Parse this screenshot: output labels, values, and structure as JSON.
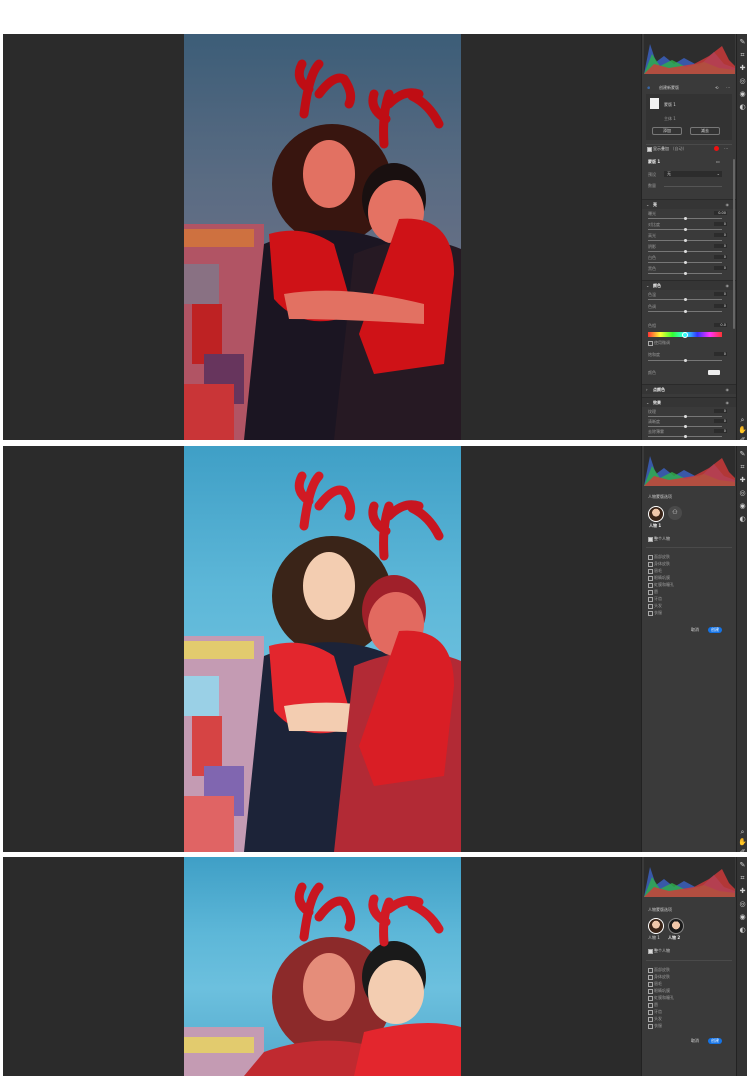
{
  "shot1": {
    "panel": {
      "mask_header": "创建新蒙版",
      "mask_name": "蒙版 1",
      "subject_label": "主体 1",
      "add_label": "添加",
      "subtract_label": "减去",
      "mask_overlay_label": "显示叠加",
      "overlay_mode": "(自动)",
      "mask_section": "蒙版 1",
      "preset_label": "预设",
      "preset_value": "无",
      "amount_label": "数量",
      "light_section": "亮",
      "sliders_light": [
        {
          "label": "曝光",
          "value": "0.00"
        },
        {
          "label": "对比度",
          "value": "0"
        },
        {
          "label": "高光",
          "value": "0"
        },
        {
          "label": "阴影",
          "value": "0"
        },
        {
          "label": "白色",
          "value": "0"
        },
        {
          "label": "黑色",
          "value": "0"
        }
      ],
      "color_section": "颜色",
      "sliders_color": [
        {
          "label": "色温",
          "value": "0"
        },
        {
          "label": "色调",
          "value": "0"
        }
      ],
      "hue_label": "色相",
      "hue_value": "0.0",
      "fine_adjust": "使用微调",
      "saturation_label": "饱和度",
      "saturation_value": "0",
      "color_label": "颜色",
      "effects_section": "点颜色",
      "detail_section": "效果",
      "sliders_detail": [
        {
          "label": "纹理",
          "value": "0"
        },
        {
          "label": "清晰度",
          "value": "0"
        },
        {
          "label": "去除薄雾",
          "value": "0"
        }
      ]
    }
  },
  "people_panel": {
    "title": "人物蒙版选项",
    "person1": "人物 1",
    "person2": "人物 2",
    "whole_person": "整个人物",
    "options": [
      "面部皮肤",
      "身体皮肤",
      "眉毛",
      "眼睛巩膜",
      "虹膜和瞳孔",
      "唇",
      "牙齿",
      "头发",
      "衣服"
    ],
    "cancel": "取消",
    "create": "创建"
  }
}
